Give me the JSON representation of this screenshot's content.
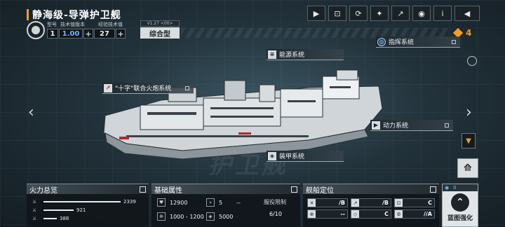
{
  "ship": {
    "title": "静海级-导弹护卫舰",
    "headers": {
      "model": "型号",
      "tech_version": "技术值版本",
      "exp_tech": "经验技术值"
    },
    "model_no": "1",
    "tech_value": "1.00",
    "exp_value": "27",
    "version": "V1.27 <00>",
    "type": "综合型",
    "deck_text": "护卫舰"
  },
  "toolbar": {
    "icons": [
      "video-icon",
      "image-icon",
      "refresh-icon",
      "gun-icon",
      "share-icon",
      "scan-icon",
      "info-icon",
      "back-icon"
    ],
    "glyphs": [
      "▶",
      "⊡",
      "⟳",
      "✦",
      "↗",
      "◉",
      "i",
      "◀"
    ]
  },
  "resource": {
    "count": "4"
  },
  "systems": {
    "command": "指挥系统",
    "energy": "能源系统",
    "artillery": "\"十字\"联合火炮系统",
    "power": "动力系统",
    "armor": "装甲系统"
  },
  "firepower": {
    "title": "火力总览",
    "rows": [
      {
        "value": "2339",
        "fraction": 1.0
      },
      {
        "value": "921",
        "fraction": 0.39
      },
      {
        "value": "388",
        "fraction": 0.17
      }
    ]
  },
  "attributes": {
    "title": "基础属性",
    "hp": "12900",
    "speed": "5",
    "speed_extra": "--",
    "range": "1000 - 1200",
    "armor": "5000",
    "limit_label": "服役限制",
    "limit_value": "6/10"
  },
  "hull": {
    "title": "舰船定位",
    "cells": [
      "/B",
      "/B",
      "C",
      "--",
      "C",
      "//A"
    ]
  },
  "blueprint": {
    "label": "蓝图强化",
    "count": "0"
  },
  "nav": {
    "left": "‹",
    "right": "›"
  }
}
